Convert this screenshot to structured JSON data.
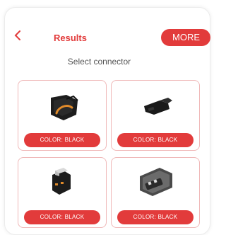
{
  "header": {
    "back_icon": "chevron-left-icon",
    "title": "Results",
    "more_label": "MORE"
  },
  "subtitle": "Select connector",
  "cards": [
    {
      "color_label": "COLOR: BLACK"
    },
    {
      "color_label": "COLOR: BLACK"
    },
    {
      "color_label": "COLOR: BLACK"
    },
    {
      "color_label": "COLOR: BLACK"
    }
  ],
  "colors": {
    "accent": "#e23b3b",
    "card_border": "#f0b8b8",
    "connector_orange": "#e08a2a"
  }
}
